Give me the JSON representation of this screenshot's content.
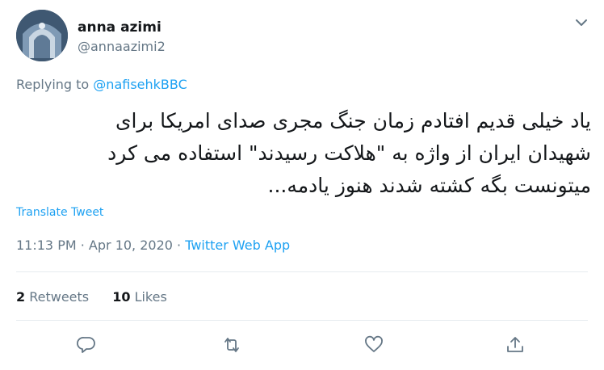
{
  "author": {
    "display_name": "anna azimi",
    "username": "@annaazimi2"
  },
  "reply": {
    "prefix": "Replying to ",
    "handle": "@nafisehkBBC"
  },
  "tweet": {
    "lines": [
      "یاد خیلی قدیم افتادم زمان جنگ مجری صدای امریکا برای",
      "شهیدان ایران از واژه به \"هلاکت رسیدند\" استفاده می کرد",
      "میتونست بگه کشته شدند هنوز یادمه..."
    ]
  },
  "translate_label": "Translate Tweet",
  "meta": {
    "time": "11:13 PM",
    "separator": " · ",
    "date": "Apr 10, 2020",
    "app": "Twitter Web App"
  },
  "stats": {
    "retweets_count": "2",
    "retweets_label": " Retweets",
    "likes_count": "10",
    "likes_label": " Likes"
  },
  "icons": {
    "more": "chevron-down-icon",
    "reply": "reply-icon",
    "retweet": "retweet-icon",
    "like": "heart-icon",
    "share": "share-icon"
  },
  "colors": {
    "accent": "#1da1f2",
    "secondary_text": "#657786",
    "primary_text": "#14171a",
    "divider": "#e6ecf0"
  }
}
